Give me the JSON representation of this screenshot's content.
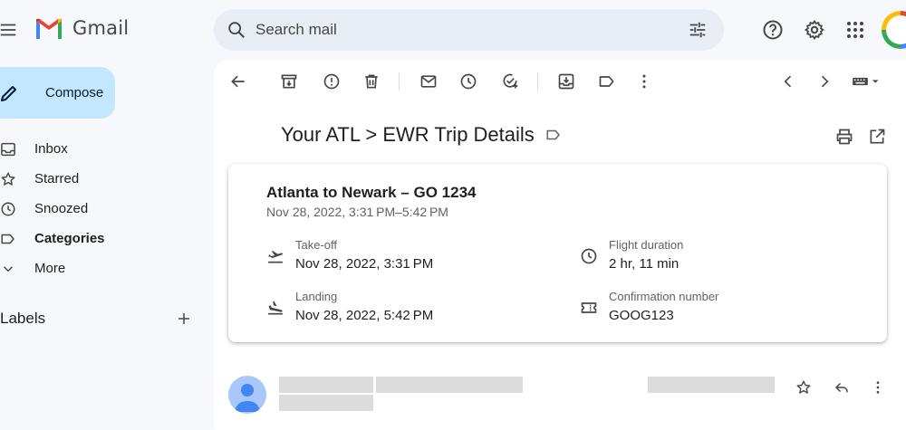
{
  "app": {
    "name": "Gmail"
  },
  "search": {
    "placeholder": "Search mail"
  },
  "compose": {
    "label": "Compose"
  },
  "nav": [
    {
      "label": "Inbox",
      "icon": "inbox-icon"
    },
    {
      "label": "Starred",
      "icon": "star-icon"
    },
    {
      "label": "Snoozed",
      "icon": "clock-icon"
    },
    {
      "label": "Categories",
      "icon": "label-icon"
    },
    {
      "label": "More",
      "icon": "chevron-down-icon"
    }
  ],
  "labels": {
    "title": "Labels"
  },
  "email": {
    "subject": "Your ATL > EWR Trip Details",
    "card": {
      "title": "Atlanta to Newark – GO 1234",
      "subtitle": "Nov 28, 2022, 3:31 PM–5:42 PM",
      "takeoff": {
        "label": "Take-off",
        "value": "Nov 28, 2022, 3:31 PM"
      },
      "landing": {
        "label": "Landing",
        "value": "Nov 28, 2022, 5:42 PM"
      },
      "duration": {
        "label": "Flight duration",
        "value": "2 hr, 11 min"
      },
      "confirmation": {
        "label": "Confirmation number",
        "value": "GOOG123"
      }
    }
  },
  "colors": {
    "background": "#f6f8fc",
    "compose": "#c2e7ff",
    "search": "#e9eef6",
    "avatar": "#a8c7fa",
    "avatar_dark": "#4285f4"
  }
}
